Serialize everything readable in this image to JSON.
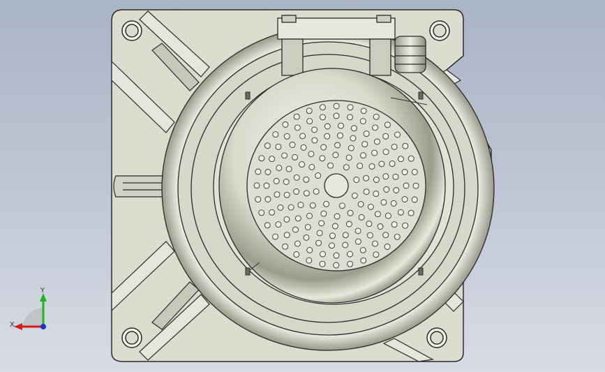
{
  "viewport": {
    "background_top": "#a9b4c6",
    "background_bottom": "#d8dce5"
  },
  "model": {
    "description_icon": "servo-motor-rear-view",
    "body_color": "#dcdccf",
    "edge_color": "#2a2a2a",
    "highlight_color": "#f6f6ee"
  },
  "triad": {
    "x_label": "X",
    "y_label": "Y",
    "x_color": "#d21c1c",
    "y_color": "#1cb81c",
    "z_color": "#2030d0"
  }
}
